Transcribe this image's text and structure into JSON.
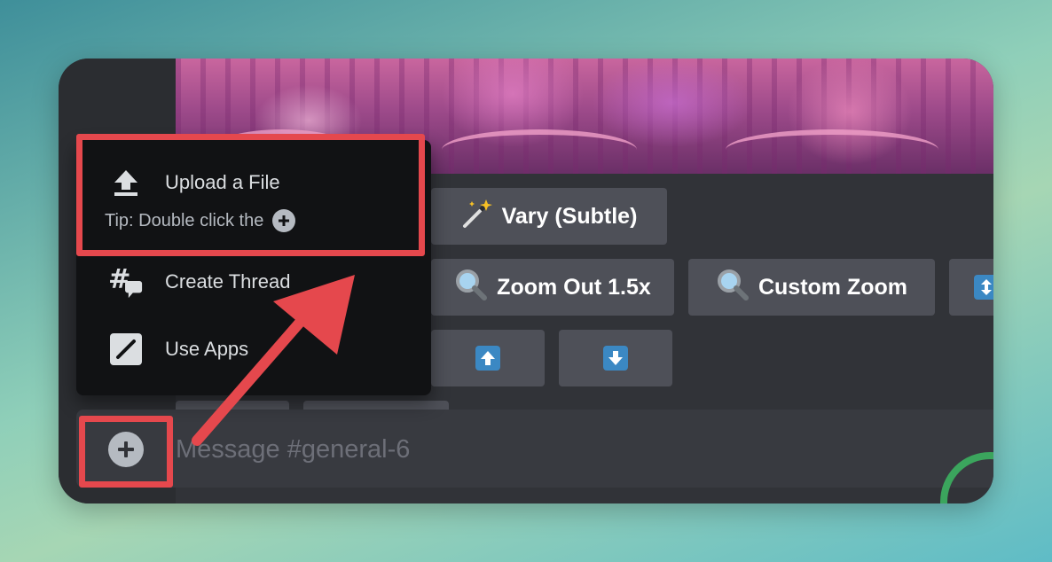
{
  "popup": {
    "upload_label": "Upload a File",
    "tip_text": "Tip: Double click the",
    "thread_label": "Create Thread",
    "apps_label": "Use Apps"
  },
  "buttons": {
    "vary_subtle": "Vary (Subtle)",
    "zoom_out": "Zoom Out 1.5x",
    "custom_zoom": "Custom Zoom"
  },
  "composer": {
    "placeholder": "Message #general-6"
  },
  "icons": {
    "upload": "upload-icon",
    "thread": "thread-icon",
    "apps": "apps-icon",
    "wand": "magic-wand-icon",
    "magnifier": "magnifier-icon",
    "up": "arrow-up-icon",
    "down": "arrow-down-icon",
    "plus": "plus-icon"
  },
  "colors": {
    "highlight": "#e5484d",
    "button_bg": "#4e5058",
    "popup_bg": "#111214",
    "accent_blue": "#3b88c3",
    "status_green": "#3ba55d"
  }
}
